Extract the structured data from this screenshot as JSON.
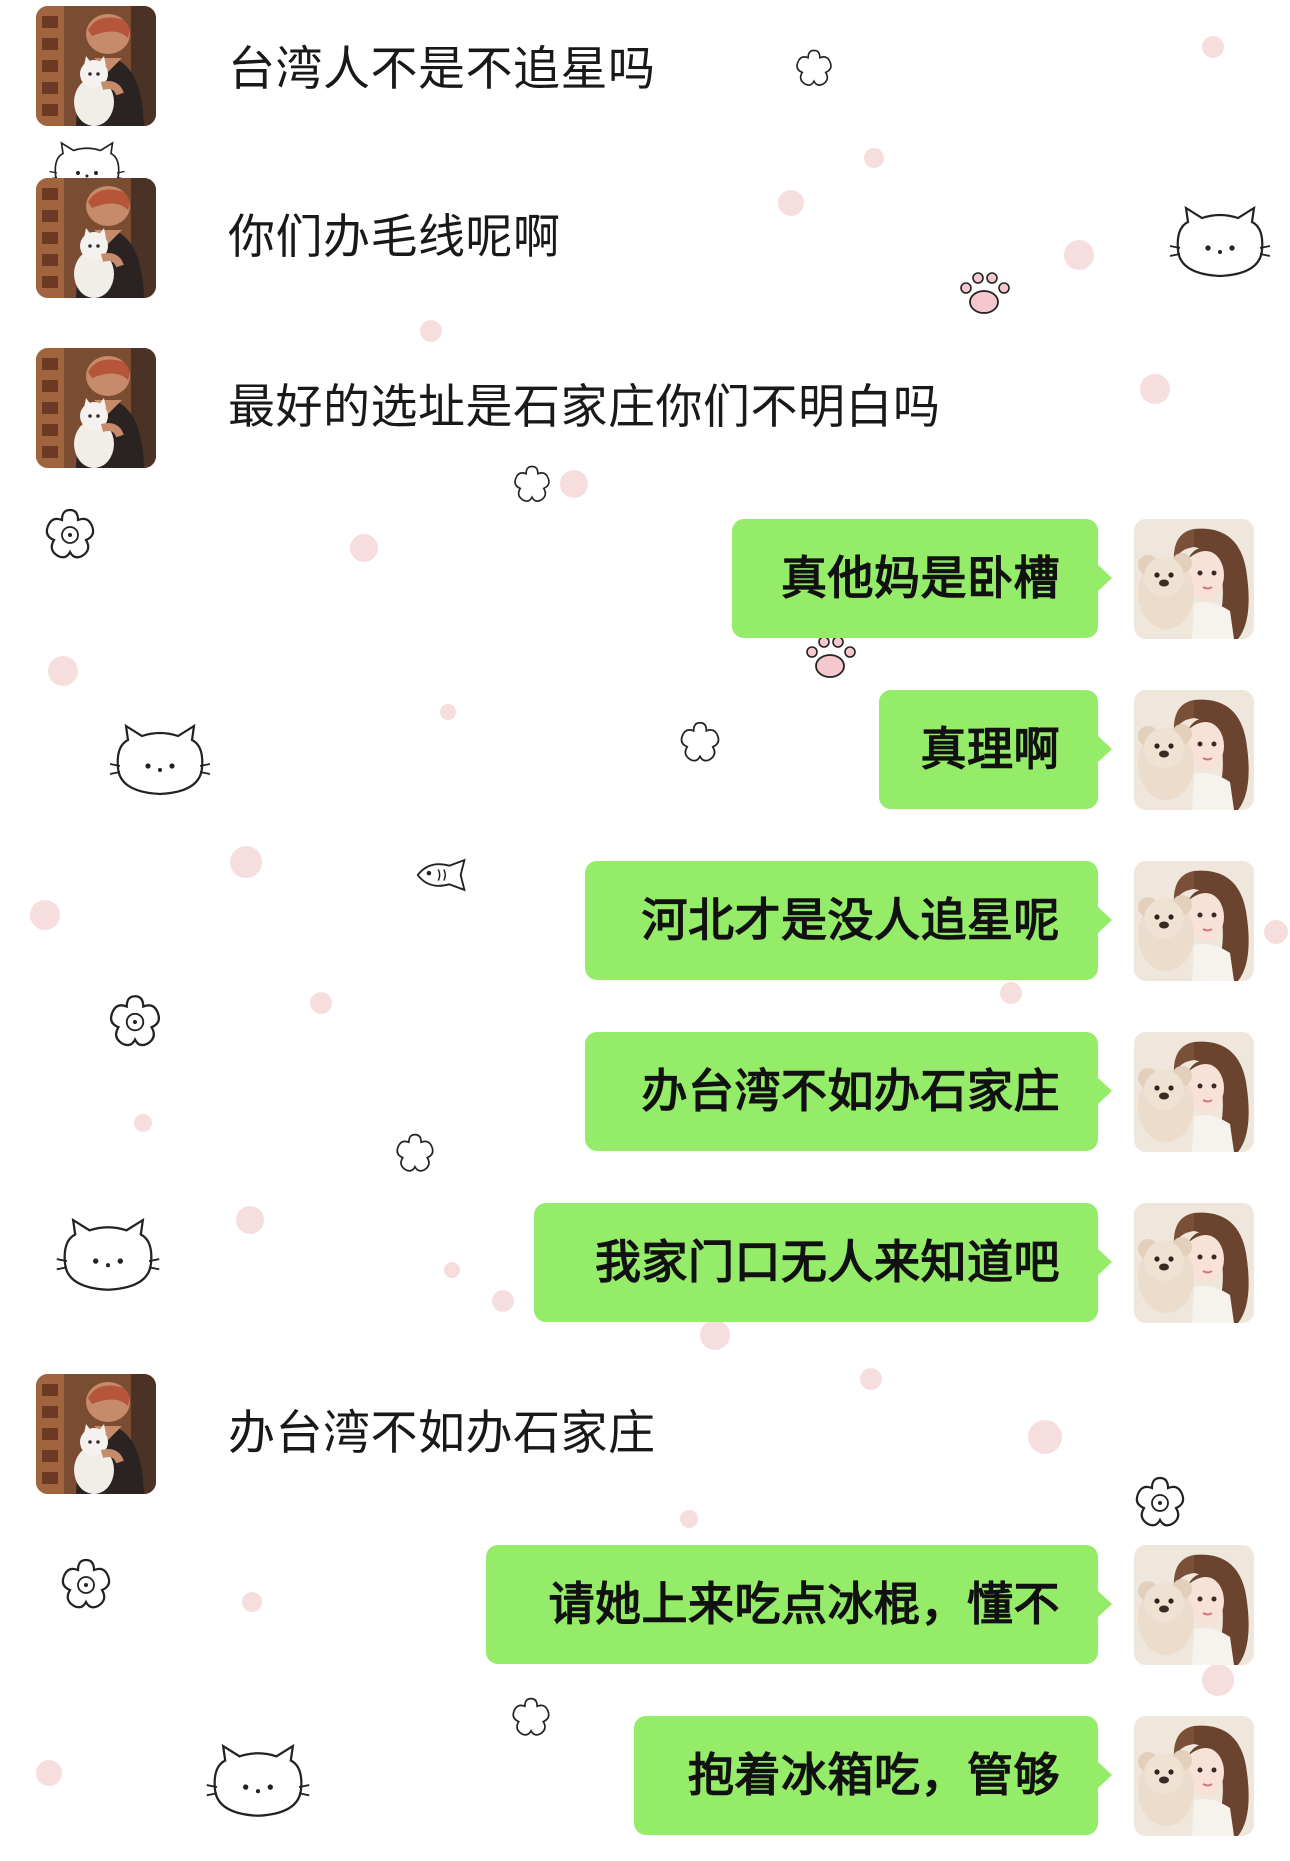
{
  "colors": {
    "background": "#ffffff",
    "bubble_green": "#95ec69",
    "text": "#191919",
    "dot_pink": "#f6dede"
  },
  "participants": {
    "other": {
      "avatar_icon": "person-with-cat-avatar-icon"
    },
    "self": {
      "avatar_icon": "girl-with-teddy-bear-avatar-icon"
    }
  },
  "messages": [
    {
      "side": "incoming",
      "text": "台湾人不是不追星吗"
    },
    {
      "side": "incoming",
      "text": "你们办毛线呢啊"
    },
    {
      "side": "incoming",
      "text": "最好的选址是石家庄你们不明白吗"
    },
    {
      "side": "outgoing",
      "text": "真他妈是卧槽"
    },
    {
      "side": "outgoing",
      "text": "真理啊"
    },
    {
      "side": "outgoing",
      "text": "河北才是没人追星呢"
    },
    {
      "side": "outgoing",
      "text": "办台湾不如办石家庄"
    },
    {
      "side": "outgoing",
      "text": "我家门口无人来知道吧"
    },
    {
      "side": "incoming",
      "text": "办台湾不如办石家庄"
    },
    {
      "side": "outgoing",
      "text": "请她上来吃点冰棍，懂不"
    },
    {
      "side": "outgoing",
      "text": "抱着冰箱吃，管够"
    }
  ],
  "background_decorations": [
    "cat-face-icon",
    "flower-icon",
    "paw-print-icon",
    "fish-icon",
    "pink-dot"
  ]
}
